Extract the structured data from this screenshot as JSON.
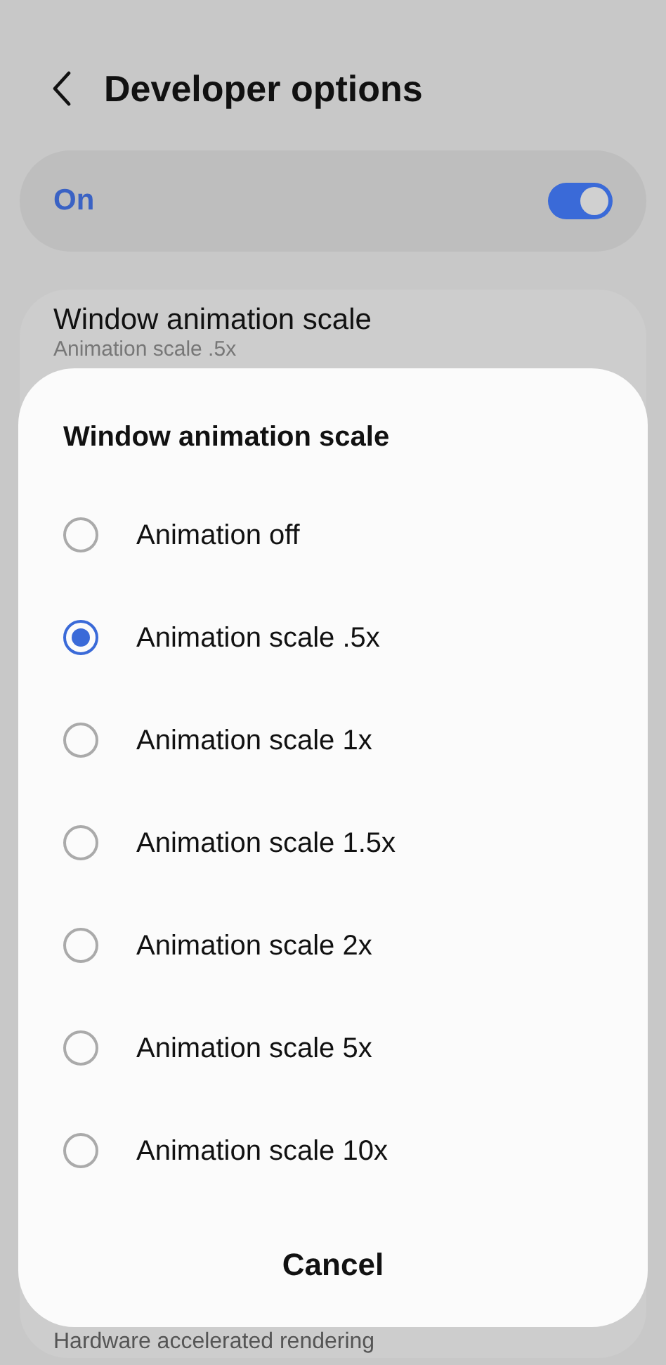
{
  "header": {
    "title": "Developer options"
  },
  "master_switch": {
    "label": "On",
    "on": true
  },
  "setting": {
    "title": "Window animation scale",
    "summary": "Animation scale .5x"
  },
  "next_setting": {
    "title": "Hardware accelerated rendering"
  },
  "dialog": {
    "title": "Window animation scale",
    "options": [
      {
        "label": "Animation off",
        "selected": false
      },
      {
        "label": "Animation scale .5x",
        "selected": true
      },
      {
        "label": "Animation scale 1x",
        "selected": false
      },
      {
        "label": "Animation scale 1.5x",
        "selected": false
      },
      {
        "label": "Animation scale 2x",
        "selected": false
      },
      {
        "label": "Animation scale 5x",
        "selected": false
      },
      {
        "label": "Animation scale 10x",
        "selected": false
      }
    ],
    "cancel": "Cancel"
  }
}
